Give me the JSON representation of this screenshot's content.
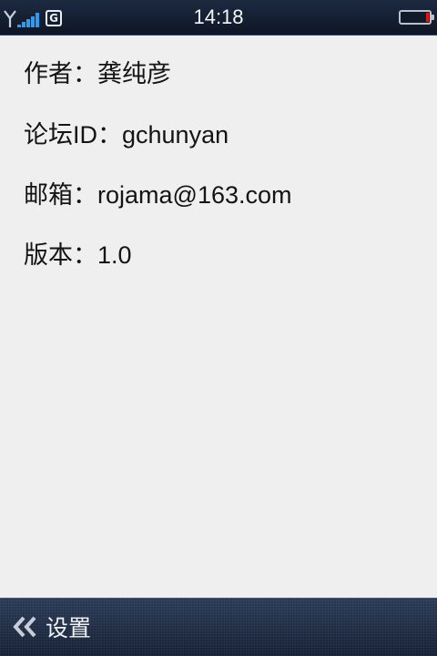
{
  "status_bar": {
    "network_type": "G",
    "time": "14:18",
    "signal_bars": 5,
    "battery_level": 0.05,
    "signal_color": "#2f9bf0",
    "battery_color": "#e01818"
  },
  "about": {
    "author": "作者：龚纯彦",
    "forum_id": "论坛ID：gchunyan",
    "email": "邮箱：rojama@163.com",
    "version": "版本：1.0"
  },
  "bottom_bar": {
    "back_label": "设置",
    "back_icon": "double-chevron-left-icon"
  }
}
